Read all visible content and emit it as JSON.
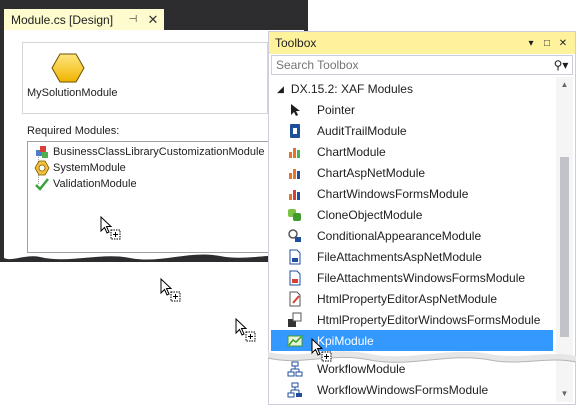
{
  "designer": {
    "tab_title": "Module.cs [Design]",
    "pin_glyph": "⊣",
    "close_glyph": "✕",
    "module_name": "MySolutionModule",
    "required_label": "Required Modules:",
    "required_modules": [
      {
        "label": "BusinessClassLibraryCustomizationModule",
        "icon": "business-class-icon"
      },
      {
        "label": "SystemModule",
        "icon": "system-module-icon"
      },
      {
        "label": "ValidationModule",
        "icon": "validation-icon"
      }
    ]
  },
  "toolbox": {
    "title": "Toolbox",
    "dropdown_glyph": "▾",
    "maximize_glyph": "□",
    "close_glyph": "✕",
    "search_placeholder": "Search Toolbox",
    "search_glyph": "⚲▾",
    "group_label": "DX.15.2: XAF Modules",
    "items": [
      {
        "label": "Pointer",
        "icon": "pointer-icon"
      },
      {
        "label": "AuditTrailModule",
        "icon": "audit-trail-icon"
      },
      {
        "label": "ChartModule",
        "icon": "chart-icon"
      },
      {
        "label": "ChartAspNetModule",
        "icon": "chart-aspnet-icon"
      },
      {
        "label": "ChartWindowsFormsModule",
        "icon": "chart-winforms-icon"
      },
      {
        "label": "CloneObjectModule",
        "icon": "clone-object-icon"
      },
      {
        "label": "ConditionalAppearanceModule",
        "icon": "conditional-appearance-icon"
      },
      {
        "label": "FileAttachmentsAspNetModule",
        "icon": "file-attachments-aspnet-icon"
      },
      {
        "label": "FileAttachmentsWindowsFormsModule",
        "icon": "file-attachments-winforms-icon"
      },
      {
        "label": "HtmlPropertyEditorAspNetModule",
        "icon": "html-editor-aspnet-icon"
      },
      {
        "label": "HtmlPropertyEditorWindowsFormsModule",
        "icon": "html-editor-winforms-icon"
      },
      {
        "label": "KpiModule",
        "icon": "kpi-icon",
        "selected": true
      },
      {
        "label": "WorkflowModule",
        "icon": "workflow-icon"
      },
      {
        "label": "WorkflowWindowsFormsModule",
        "icon": "workflow-winforms-icon"
      }
    ]
  },
  "colors": {
    "tab_active": "#fefccf",
    "toolbox_title": "#fff29d",
    "selection": "#3399ff",
    "window_border": "#2d2d30"
  }
}
